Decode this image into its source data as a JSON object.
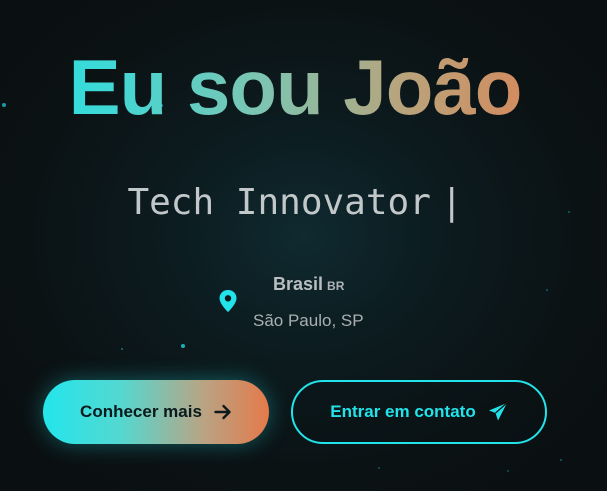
{
  "hero": {
    "title": "Eu sou João",
    "typed_text": "Tech Innovator",
    "cursor": "|"
  },
  "location": {
    "icon": "map-pin-icon",
    "country": "Brasil",
    "flag_code": "BR",
    "city": "São Paulo, SP"
  },
  "actions": {
    "primary_label": "Conhecer mais",
    "primary_icon": "arrow-right-icon",
    "secondary_label": "Entrar em contato",
    "secondary_icon": "send-icon"
  },
  "colors": {
    "accent": "#22e3ea",
    "gradient_start": "#20e3e6",
    "gradient_end": "#e07f4f",
    "background": "#0b1214"
  }
}
